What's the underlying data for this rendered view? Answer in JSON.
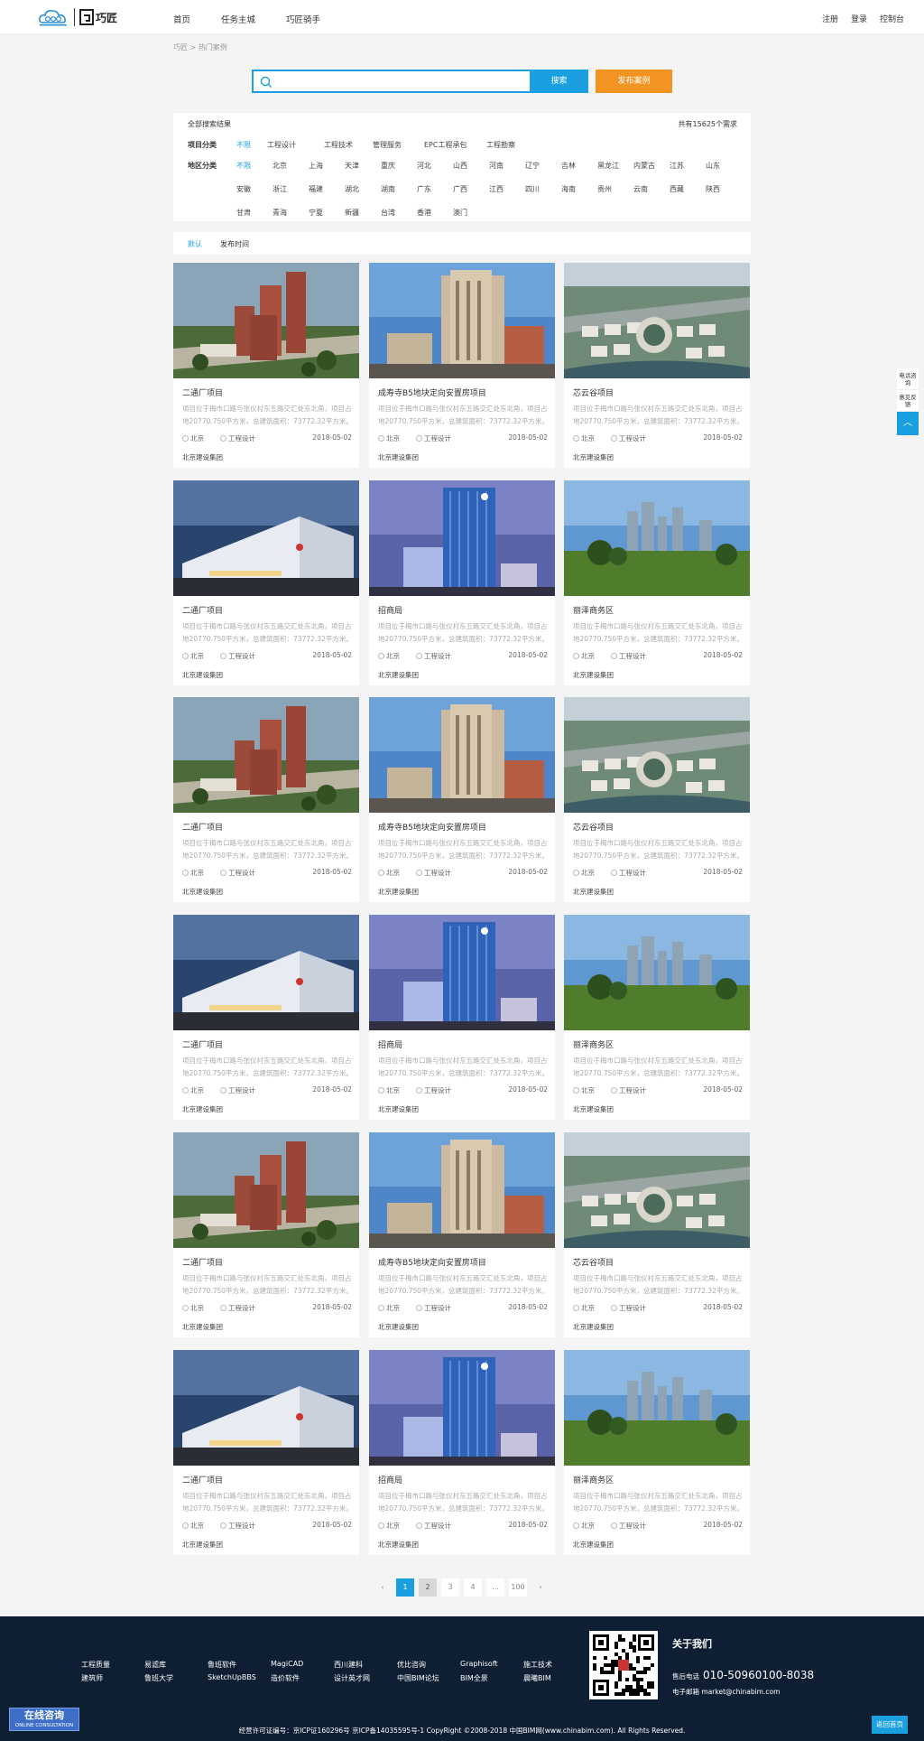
{
  "header": {
    "logo_text": "巧匠",
    "nav": [
      "首页",
      "任务主城",
      "巧匠骑手"
    ],
    "links": [
      "注册",
      "登录",
      "控制台"
    ]
  },
  "breadcrumb": "巧匠 > 热门案例",
  "search": {
    "placeholder": "",
    "button": "搜索",
    "publish": "发布案例"
  },
  "filter": {
    "heading": "全部搜索结果",
    "total": "共有15625个需求",
    "project_label": "项目分类",
    "project_options": [
      "不限",
      "工程设计",
      "工程技术",
      "管理服务",
      "EPC工程承包",
      "工程勘察"
    ],
    "region_label": "地区分类",
    "region_rows": [
      [
        "不限",
        "北京",
        "上海",
        "天津",
        "重庆",
        "河北",
        "山西",
        "河南",
        "辽宁",
        "吉林",
        "黑龙江",
        "内蒙古",
        "江苏",
        "山东"
      ],
      [
        "安徽",
        "浙江",
        "福建",
        "湖北",
        "湖南",
        "广东",
        "广西",
        "江西",
        "四川",
        "海南",
        "贵州",
        "云南",
        "西藏",
        "陕西"
      ],
      [
        "甘肃",
        "青海",
        "宁夏",
        "新疆",
        "台湾",
        "香港",
        "澳门"
      ]
    ]
  },
  "sort": {
    "default": "默认",
    "time": "发布时间"
  },
  "cards": [
    {
      "title": "二通厂项目",
      "desc": "项目位于梅市口路与张仪村东五路交汇处东北角，项目占地20770.750平方米，总建筑面积：73772.32平方米。",
      "city": "北京",
      "type": "工程设计",
      "date": "2018-05-02",
      "org": "北京建设集团"
    },
    {
      "title": "成寿寺B5地块定向安置房项目",
      "desc": "项目位于梅市口路与张仪村东五路交汇处东北角，项目占地20770.750平方米，总建筑面积：73772.32平方米。",
      "city": "北京",
      "type": "工程设计",
      "date": "2018-05-02",
      "org": "北京建设集团"
    },
    {
      "title": "芯云谷项目",
      "desc": "项目位于梅市口路与张仪村东五路交汇处东北角，项目占地20770.750平方米，总建筑面积：73772.32平方米。",
      "city": "北京",
      "type": "工程设计",
      "date": "2018-05-02",
      "org": "北京建设集团"
    },
    {
      "title": "二通厂项目",
      "desc": "项目位于梅市口路与张仪村东五路交汇处东北角，项目占地20770.750平方米，总建筑面积：73772.32平方米。",
      "city": "北京",
      "type": "工程设计",
      "date": "2018-05-02",
      "org": "北京建设集团"
    },
    {
      "title": "招商局",
      "desc": "项目位于梅市口路与张仪村东五路交汇处东北角，项目占地20770.750平方米，总建筑面积：73772.32平方米。",
      "city": "北京",
      "type": "工程设计",
      "date": "2018-05-02",
      "org": "北京建设集团"
    },
    {
      "title": "丽泽商务区",
      "desc": "项目位于梅市口路与张仪村东五路交汇处东北角，项目占地20770.750平方米，总建筑面积：73772.32平方米。",
      "city": "北京",
      "type": "工程设计",
      "date": "2018-05-02",
      "org": "北京建设集团"
    },
    {
      "title": "二通厂项目",
      "desc": "项目位于梅市口路与张仪村东五路交汇处东北角，项目占地20770.750平方米，总建筑面积：73772.32平方米。",
      "city": "北京",
      "type": "工程设计",
      "date": "2018-05-02",
      "org": "北京建设集团"
    },
    {
      "title": "成寿寺B5地块定向安置房项目",
      "desc": "项目位于梅市口路与张仪村东五路交汇处东北角，项目占地20770.750平方米，总建筑面积：73772.32平方米。",
      "city": "北京",
      "type": "工程设计",
      "date": "2018-05-02",
      "org": "北京建设集团"
    },
    {
      "title": "芯云谷项目",
      "desc": "项目位于梅市口路与张仪村东五路交汇处东北角，项目占地20770.750平方米，总建筑面积：73772.32平方米。",
      "city": "北京",
      "type": "工程设计",
      "date": "2018-05-02",
      "org": "北京建设集团"
    },
    {
      "title": "二通厂项目",
      "desc": "项目位于梅市口路与张仪村东五路交汇处东北角，项目占地20770.750平方米，总建筑面积：73772.32平方米。",
      "city": "北京",
      "type": "工程设计",
      "date": "2018-05-02",
      "org": "北京建设集团"
    },
    {
      "title": "招商局",
      "desc": "项目位于梅市口路与张仪村东五路交汇处东北角，项目占地20770.750平方米，总建筑面积：73772.32平方米。",
      "city": "北京",
      "type": "工程设计",
      "date": "2018-05-02",
      "org": "北京建设集团"
    },
    {
      "title": "丽泽商务区",
      "desc": "项目位于梅市口路与张仪村东五路交汇处东北角，项目占地20770.750平方米，总建筑面积：73772.32平方米。",
      "city": "北京",
      "type": "工程设计",
      "date": "2018-05-02",
      "org": "北京建设集团"
    },
    {
      "title": "二通厂项目",
      "desc": "项目位于梅市口路与张仪村东五路交汇处东北角，项目占地20770.750平方米，总建筑面积：73772.32平方米。",
      "city": "北京",
      "type": "工程设计",
      "date": "2018-05-02",
      "org": "北京建设集团"
    },
    {
      "title": "成寿寺B5地块定向安置房项目",
      "desc": "项目位于梅市口路与张仪村东五路交汇处东北角，项目占地20770.750平方米，总建筑面积：73772.32平方米。",
      "city": "北京",
      "type": "工程设计",
      "date": "2018-05-02",
      "org": "北京建设集团"
    },
    {
      "title": "芯云谷项目",
      "desc": "项目位于梅市口路与张仪村东五路交汇处东北角，项目占地20770.750平方米，总建筑面积：73772.32平方米。",
      "city": "北京",
      "type": "工程设计",
      "date": "2018-05-02",
      "org": "北京建设集团"
    },
    {
      "title": "二通厂项目",
      "desc": "项目位于梅市口路与张仪村东五路交汇处东北角，项目占地20770.750平方米，总建筑面积：73772.32平方米。",
      "city": "北京",
      "type": "工程设计",
      "date": "2018-05-02",
      "org": "北京建设集团"
    },
    {
      "title": "招商局",
      "desc": "项目位于梅市口路与张仪村东五路交汇处东北角，项目占地20770.750平方米，总建筑面积：73772.32平方米。",
      "city": "北京",
      "type": "工程设计",
      "date": "2018-05-02",
      "org": "北京建设集团"
    },
    {
      "title": "丽泽商务区",
      "desc": "项目位于梅市口路与张仪村东五路交汇处东北角，项目占地20770.750平方米，总建筑面积：73772.32平方米。",
      "city": "北京",
      "type": "工程设计",
      "date": "2018-05-02",
      "org": "北京建设集团"
    }
  ],
  "pagination": {
    "prev": "‹",
    "pages": [
      "1",
      "2",
      "3",
      "4",
      "...",
      "100"
    ],
    "next": "›"
  },
  "side_tools": {
    "phone": "电话咨询",
    "feedback": "意见反馈",
    "top": "︿"
  },
  "footer": {
    "links": [
      [
        "工程质量",
        "易滤库",
        "鲁班软件",
        "MagiCAD",
        "西川建科",
        "优比咨询",
        "Graphisoft",
        "施工技术"
      ],
      [
        "建筑师",
        "鲁班大学",
        "SketchUpBBS",
        "造价软件",
        "设计英才网",
        "中国BIM论坛",
        "BIM全景",
        "晨曦BIM"
      ]
    ],
    "about_title": "关于我们",
    "tel_label": "售后电话",
    "tel": "010-50960100-8038",
    "mail_label": "电子邮箱",
    "mail": "market@chinabim.com",
    "copyright": "经营许可证编号：京ICP证160296号 京ICP备14035595号-1 CopyRight ©2008-2018 中国BIM网(www.chinabim.com). All Rights Reserved.",
    "online_main": "在线咨询",
    "online_sub": "ONLINE CONSULTATION",
    "back_home": "返回首页"
  },
  "colors": {
    "accent": "#1a9fe0",
    "publish": "#f39422",
    "footer_bg": "#0e1f33"
  }
}
